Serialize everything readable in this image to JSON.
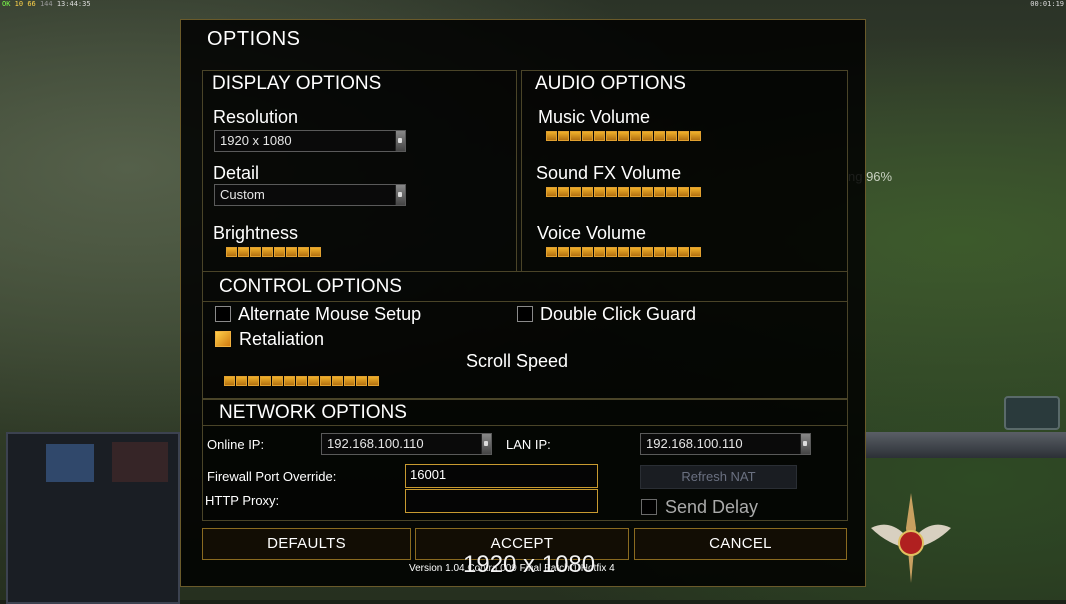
{
  "status_bar": {
    "left_a": "OK",
    "left_b": "10",
    "left_c": "66",
    "left_d": "144",
    "clock": "13:44:35",
    "timer": "00:01:19"
  },
  "background_progress": "ng 96%",
  "dialog": {
    "title": "OPTIONS",
    "display": {
      "header": "DISPLAY OPTIONS",
      "resolution_label": "Resolution",
      "resolution_value": "1920 x 1080",
      "detail_label": "Detail",
      "detail_value": "Custom",
      "brightness_label": "Brightness",
      "brightness_level": 8,
      "brightness_max": 8
    },
    "audio": {
      "header": "AUDIO OPTIONS",
      "music_label": "Music Volume",
      "music_level": 13,
      "sfx_label": "Sound FX Volume",
      "sfx_level": 13,
      "voice_label": "Voice Volume",
      "voice_level": 13,
      "max": 13
    },
    "control": {
      "header": "CONTROL OPTIONS",
      "alt_mouse_label": "Alternate Mouse Setup",
      "alt_mouse_checked": false,
      "double_click_label": "Double Click Guard",
      "double_click_checked": false,
      "retaliation_label": "Retaliation",
      "retaliation_checked": true,
      "scroll_label": "Scroll Speed",
      "scroll_level": 13,
      "scroll_max": 13
    },
    "network": {
      "header": "NETWORK OPTIONS",
      "online_ip_label": "Online IP:",
      "online_ip_value": "192.168.100.110",
      "lan_ip_label": "LAN IP:",
      "lan_ip_value": "192.168.100.110",
      "firewall_label": "Firewall Port Override:",
      "firewall_value": "16001",
      "proxy_label": "HTTP Proxy:",
      "proxy_value": "",
      "refresh_nat_label": "Refresh NAT",
      "send_delay_label": "Send Delay",
      "send_delay_checked": false
    },
    "buttons": {
      "defaults": "DEFAULTS",
      "accept": "ACCEPT",
      "cancel": "CANCEL"
    },
    "version": "Version 1.04 Contra 009 Final Patch 1 Hotfix 4",
    "resolution_overlay": "1920 x 1080"
  },
  "colors": {
    "accent": "#c89a30",
    "slider_on": "#f0b02a",
    "border": "#6a5a2a"
  }
}
